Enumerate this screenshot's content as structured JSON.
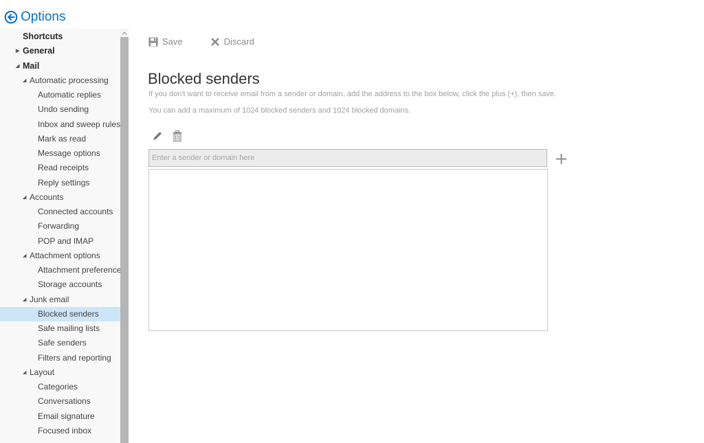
{
  "header": {
    "title": "Options",
    "back_icon": "back-arrow-circle-icon",
    "accent_color": "#0072c6"
  },
  "sidebar": {
    "items": [
      {
        "label": "Shortcuts",
        "level": 0,
        "arrow": ""
      },
      {
        "label": "General",
        "level": 0,
        "arrow": "collapsed"
      },
      {
        "label": "Mail",
        "level": 0,
        "arrow": "expanded"
      },
      {
        "label": "Automatic processing",
        "level": 1,
        "arrow": "expanded"
      },
      {
        "label": "Automatic replies",
        "level": 2,
        "arrow": ""
      },
      {
        "label": "Undo sending",
        "level": 2,
        "arrow": ""
      },
      {
        "label": "Inbox and sweep rules",
        "level": 2,
        "arrow": ""
      },
      {
        "label": "Mark as read",
        "level": 2,
        "arrow": ""
      },
      {
        "label": "Message options",
        "level": 2,
        "arrow": ""
      },
      {
        "label": "Read receipts",
        "level": 2,
        "arrow": ""
      },
      {
        "label": "Reply settings",
        "level": 2,
        "arrow": ""
      },
      {
        "label": "Accounts",
        "level": 1,
        "arrow": "expanded"
      },
      {
        "label": "Connected accounts",
        "level": 2,
        "arrow": ""
      },
      {
        "label": "Forwarding",
        "level": 2,
        "arrow": ""
      },
      {
        "label": "POP and IMAP",
        "level": 2,
        "arrow": ""
      },
      {
        "label": "Attachment options",
        "level": 1,
        "arrow": "expanded"
      },
      {
        "label": "Attachment preferences",
        "level": 2,
        "arrow": ""
      },
      {
        "label": "Storage accounts",
        "level": 2,
        "arrow": ""
      },
      {
        "label": "Junk email",
        "level": 1,
        "arrow": "expanded"
      },
      {
        "label": "Blocked senders",
        "level": 2,
        "arrow": "",
        "selected": true
      },
      {
        "label": "Safe mailing lists",
        "level": 2,
        "arrow": ""
      },
      {
        "label": "Safe senders",
        "level": 2,
        "arrow": ""
      },
      {
        "label": "Filters and reporting",
        "level": 2,
        "arrow": ""
      },
      {
        "label": "Layout",
        "level": 1,
        "arrow": "expanded"
      },
      {
        "label": "Categories",
        "level": 2,
        "arrow": ""
      },
      {
        "label": "Conversations",
        "level": 2,
        "arrow": ""
      },
      {
        "label": "Email signature",
        "level": 2,
        "arrow": ""
      },
      {
        "label": "Focused inbox",
        "level": 2,
        "arrow": ""
      }
    ],
    "selected_color": "#cde6f7"
  },
  "toolbar": {
    "save_label": "Save",
    "save_icon": "floppy-disk-icon",
    "discard_label": "Discard",
    "discard_icon": "x-icon"
  },
  "main": {
    "title": "Blocked senders",
    "description_1": "If you don't want to receive email from a sender or domain, add the address to the box below, click the plus (+), then save.",
    "description_2": "You can add a maximum of 1024 blocked senders and 1024 blocked domains.",
    "edit_icon": "pencil-icon",
    "delete_icon": "trash-icon",
    "input_placeholder": "Enter a sender or domain here",
    "input_value": "",
    "add_icon": "plus-icon",
    "blocked_list": []
  }
}
